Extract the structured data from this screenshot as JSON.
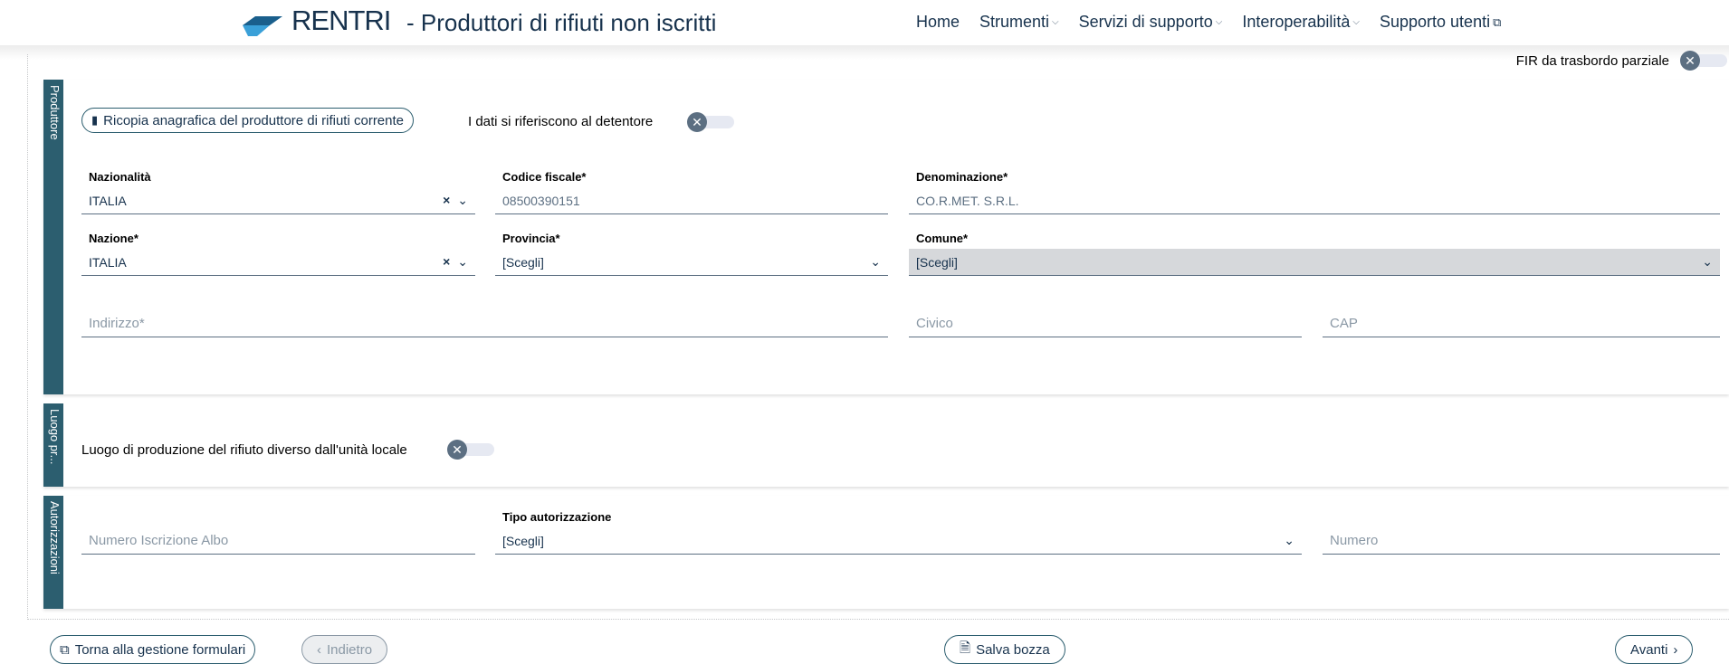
{
  "header": {
    "brand": "RENTRI",
    "subtitle": "- Produttori di rifiuti non iscritti",
    "nav": [
      {
        "label": "Home",
        "dropdown": false,
        "external": false
      },
      {
        "label": "Strumenti",
        "dropdown": true,
        "external": false
      },
      {
        "label": "Servizi di supporto",
        "dropdown": true,
        "external": false
      },
      {
        "label": "Interoperabilità",
        "dropdown": true,
        "external": false
      },
      {
        "label": "Supporto utenti",
        "dropdown": false,
        "external": true
      }
    ]
  },
  "fir_trasbordo": {
    "label": "FIR da trasbordo parziale",
    "enabled": false
  },
  "produttore": {
    "tab_label": "Produttore",
    "copy_button": "Ricopia anagrafica del produttore di rifiuti corrente",
    "detentore_toggle_label": "I dati si riferiscono al detentore",
    "detentore_enabled": false,
    "nazionalita": {
      "label": "Nazionalità",
      "value": "ITALIA"
    },
    "codice_fiscale": {
      "label": "Codice fiscale*",
      "value": "08500390151"
    },
    "denominazione": {
      "label": "Denominazione*",
      "value": "CO.R.MET. S.R.L."
    },
    "nazione": {
      "label": "Nazione*",
      "value": "ITALIA"
    },
    "provincia": {
      "label": "Provincia*",
      "value": "[Scegli]"
    },
    "comune": {
      "label": "Comune*",
      "value": "[Scegli]"
    },
    "indirizzo": {
      "placeholder": "Indirizzo*"
    },
    "civico": {
      "placeholder": "Civico"
    },
    "cap": {
      "placeholder": "CAP"
    }
  },
  "luogo": {
    "tab_label": "Luogo pr...",
    "toggle_label": "Luogo di produzione del rifiuto diverso dall'unità locale",
    "enabled": false
  },
  "autorizzazioni": {
    "tab_label": "Autorizzazioni",
    "numero_albo": {
      "placeholder": "Numero Iscrizione Albo"
    },
    "tipo": {
      "label": "Tipo autorizzazione",
      "value": "[Scegli]"
    },
    "numero": {
      "placeholder": "Numero"
    }
  },
  "footer": {
    "torna": "Torna alla gestione formulari",
    "indietro": "Indietro",
    "salva": "Salva bozza",
    "avanti": "Avanti"
  },
  "colors": {
    "section_tab": "#2c5e6f",
    "text_primary": "#17324d",
    "toggle_knob": "#5c6f82",
    "logo_dark": "#1a5f8c",
    "logo_light": "#3aa0d8"
  },
  "icons": {
    "logo": "rentri-logo-icon",
    "copy": "copy-icon",
    "external_link": "external-link-icon",
    "chevron_left": "chevron-left-icon",
    "chevron_right": "chevron-right-icon",
    "document": "document-icon",
    "clear": "close-icon",
    "chevron_down": "chevron-down-icon"
  }
}
